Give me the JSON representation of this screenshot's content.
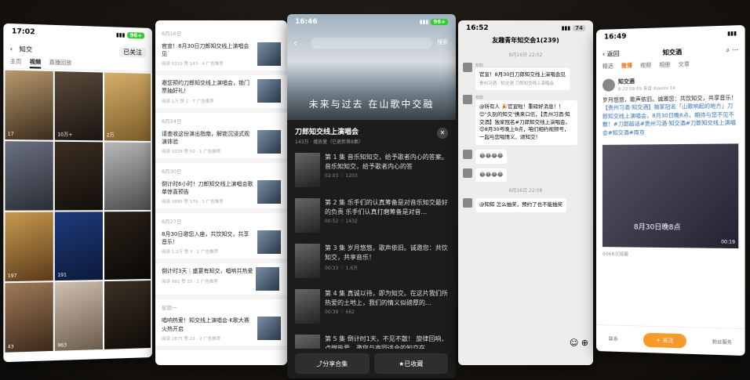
{
  "p1": {
    "time": "17:02",
    "battery": "96+",
    "name": "知交",
    "follow": "已关注",
    "tabs": [
      "主页",
      "视频",
      "直播回放"
    ],
    "tiles": [
      {
        "c": "",
        "v": "17"
      },
      {
        "c": "",
        "v": "10万+"
      },
      {
        "c": "",
        "v": "2万"
      },
      {
        "c": "",
        "v": ""
      },
      {
        "c": "",
        "v": ""
      },
      {
        "c": "",
        "v": ""
      },
      {
        "c": "",
        "v": "197"
      },
      {
        "c": "",
        "v": "191"
      },
      {
        "c": "",
        "v": ""
      },
      {
        "c": "",
        "v": "43"
      },
      {
        "c": "",
        "v": "963"
      },
      {
        "c": "",
        "v": ""
      }
    ]
  },
  "p2": {
    "items": [
      {
        "d": "8月16日",
        "t": "官宣！8月30日刀郎知交线上演唱会见",
        "m": "阅读 5319 赞 143 · 4 广告推荐"
      },
      {
        "d": "",
        "t": "邀您预约刀郎知交线上演唱会，锁门票抽好礼！",
        "m": "阅读 1万 赞 1 · 7 广告推荐"
      },
      {
        "d": "8月24日",
        "t": "请查收这份演出指南，解锁沉浸式观演体验",
        "m": "阅读 3328 赞 50 · 1 广告推荐"
      },
      {
        "d": "8月30日",
        "t": "倒计时6小时！刀郎知交线上演唱会歌单惊喜预告",
        "m": "阅读 3895 赞 179 · 1 广告推荐"
      },
      {
        "d": "8月27日",
        "t": "8月30日邀您入座，共饮知交，共享音乐！",
        "m": "阅读 1.2万 赞 3 · 1 广告推荐"
      },
      {
        "d": "",
        "t": "倒计时3天｜盛宴有知交，唱响共热爱",
        "m": "阅读 981 赞 15 · 1 广告推荐"
      },
      {
        "d": "星期一",
        "t": "唱响热爱！知交线上演唱会·K歌大赛火热开启",
        "m": "阅读 2875 赞 23 · 2 广告推荐"
      }
    ]
  },
  "p3": {
    "time": "16:46",
    "battery": "96+",
    "search": "搜索",
    "slogan": "未来与过去 在山歌中交融",
    "title": "刀郎知交线上演唱会",
    "sub": "143万 · 播放量（已更新第8集）",
    "eps": [
      {
        "t": "第 1 集  音乐知知交，给予歌者内心的答案。 音乐知知交，给予歌者内心的答",
        "d": "02:03",
        "l": "1203"
      },
      {
        "t": "第 2 集  乐手们的认真筹备是对音乐知交最好的负责 乐手们认真打磨筹备是对音...",
        "d": "00:52",
        "l": "1432"
      },
      {
        "t": "第 3 集  岁月悠悠，歌声依旧。诚邀您：共饮知交，共享音乐！",
        "d": "00:33",
        "l": "1.6万"
      },
      {
        "t": "第 4 集  真诚以待，即为知交。在这片我们所热爱的土地上，我们的情义似磅厚的...",
        "d": "00:39",
        "l": "662"
      },
      {
        "t": "第 5 集  倒计时1天，不见不散！ 旋律回响，点燃热爱，邀您与高同适合的知交在...",
        "d": "",
        "l": ""
      }
    ],
    "share": "分享合集",
    "saved": "已收藏"
  },
  "p4": {
    "time": "16:52",
    "battery": "74",
    "title": "友趣青年知交会1(239)",
    "msgs": [
      {
        "ts": "8月16日 22:02"
      },
      {
        "n": "知知",
        "t": "官宣！8月30日刀郎知交线上演唱会见",
        "card": "贵州习酒 · 知交酒 刀郎知交线上演唱会"
      },
      {
        "n": "知知",
        "t": "@所有人 🎉官宣啦！重磅好消息！！ 😊\"久别的知交\"携来口信，【贵州习酒·知交酒】独家冠名#刀郎知交线上演唱会。 😊8月30号晚上8点，咱们相约视频号，一起与您唱情义、颂知交！"
      },
      {
        "n": "",
        "t": "😂😂😂😂"
      },
      {
        "n": "",
        "t": "😂😂😂😂"
      },
      {
        "ts": "8月16日 22:08"
      },
      {
        "n": "",
        "t": "@知知 怎么抽奖，预约了也不能抽奖"
      }
    ]
  },
  "p5": {
    "time": "16:49",
    "back": "返回",
    "name": "知交酒",
    "tabs": [
      "精选",
      "微博",
      "视频",
      "相册",
      "文章"
    ],
    "user": "知交酒",
    "meta": "8-22 09:59 来自 Xiaomi 14",
    "post": "岁月悠悠，歌声依旧。诚邀您：共饮知交，共享音乐！",
    "link": "【贵州习酒·知交酒】独家冠名「山歌响起的地方」刀郎知交线上演唱会，8月30日晚8点，期待与您不见不散！#刀郎超话#贵州习酒·知交酒#刀郎知交线上演唱会#知交酒#南京",
    "cap": "8月30日晚8点",
    "dur": "00:19",
    "plays": "6068次观看",
    "follow": "+ 关注",
    "bot": [
      "联系",
      "",
      "粉丝服务"
    ]
  }
}
